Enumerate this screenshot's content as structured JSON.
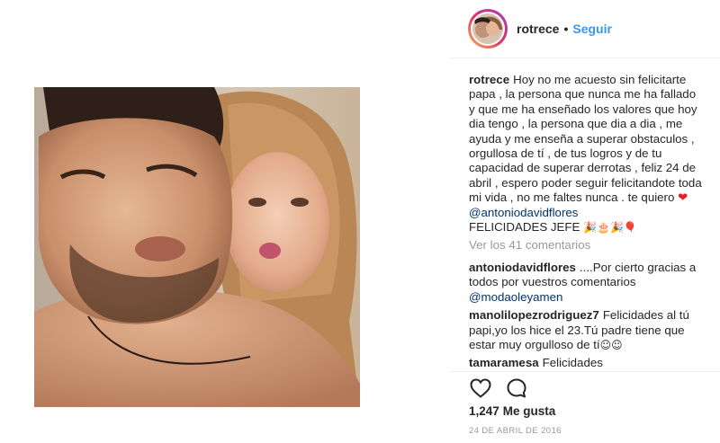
{
  "post": {
    "username": "rotrece",
    "separator": "•",
    "follow_label": "Seguir"
  },
  "caption": {
    "username": "rotrece",
    "text_main": "Hoy no me acuesto sin felicitarte papa , la persona que nunca me ha fallado y que me ha enseñado los valores que hoy dia tengo , la persona que dia a dia , me ayuda y me enseña a superar obstaculos , orgullosa de tí , de tus logros y de tu capacidad de superar derrotas , feliz 24 de abril , espero poder seguir felicitandote toda mi vida , no me faltes nunca . te quiero",
    "heart": "❤",
    "mention": "@antoniodavidflores",
    "text_end": "FELICIDADES JEFE",
    "emojis": "🎉🎂🎉🎈"
  },
  "view_all_comments": "Ver los 41 comentarios",
  "comments": [
    {
      "username": "antoniodavidflores",
      "text": "....Por cierto gracias a todos por vuestros comentarios",
      "mention": "@modaoleyamen"
    },
    {
      "username": "manolilopezrodriguez7",
      "text": "Felicidades al tú papi,yo los hice el 23.Tú padre tiene que estar muy orgulloso de tí",
      "emojis": "☺☺"
    },
    {
      "username": "tamaramesa",
      "text": "Felicidades"
    }
  ],
  "actions": {
    "like_icon": "heart-outline-icon",
    "comment_icon": "speech-bubble-icon"
  },
  "likes": {
    "count": "1,247",
    "label": "Me gusta"
  },
  "date": "24 DE ABRIL DE 2016"
}
